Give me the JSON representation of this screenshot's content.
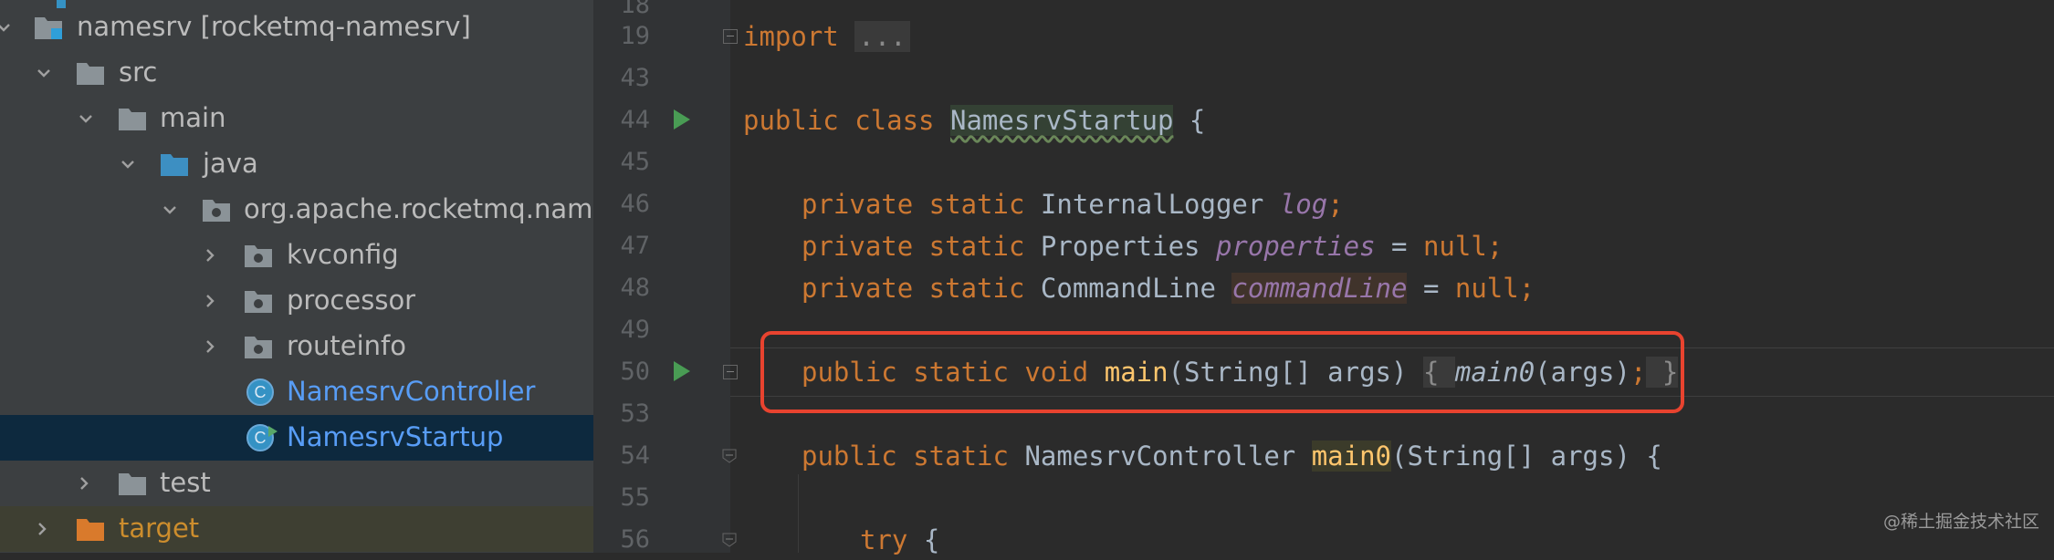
{
  "tree": {
    "items": [
      {
        "label": "namesrv [rocketmq-namesrv]",
        "kind": "module"
      },
      {
        "label": "src",
        "kind": "folder"
      },
      {
        "label": "main",
        "kind": "folder"
      },
      {
        "label": "java",
        "kind": "source-folder"
      },
      {
        "label": "org.apache.rocketmq.nam",
        "kind": "package"
      },
      {
        "label": "kvconfig",
        "kind": "package"
      },
      {
        "label": "processor",
        "kind": "package"
      },
      {
        "label": "routeinfo",
        "kind": "package"
      },
      {
        "label": "NamesrvController",
        "kind": "class"
      },
      {
        "label": "NamesrvStartup",
        "kind": "class-runnable",
        "selected": true
      },
      {
        "label": "test",
        "kind": "folder"
      },
      {
        "label": "target",
        "kind": "excluded-folder"
      }
    ]
  },
  "editor": {
    "lines": [
      {
        "num": "18"
      },
      {
        "num": "19",
        "text": "import",
        "folded": "..."
      },
      {
        "num": "43"
      },
      {
        "num": "44",
        "kw": "public class ",
        "name": "NamesrvStartup",
        "rest": " {"
      },
      {
        "num": "45"
      },
      {
        "num": "46",
        "kw": "private static ",
        "type": "InternalLogger ",
        "field": "log",
        "rest": ";"
      },
      {
        "num": "47",
        "kw": "private static ",
        "type": "Properties ",
        "field": "properties",
        "rest": " = ",
        "lit": "null",
        "end": ";"
      },
      {
        "num": "48",
        "kw": "private static ",
        "type": "CommandLine ",
        "field": "commandLine",
        "rest": " = ",
        "lit": "null",
        "end": ";"
      },
      {
        "num": "49"
      },
      {
        "num": "50",
        "kw": "public static void ",
        "method": "main",
        "params": "(String[] args) ",
        "brace_open": "{ ",
        "call": "main0",
        "args": "(args)",
        "semi": ";",
        "brace_close": " }"
      },
      {
        "num": "53"
      },
      {
        "num": "54",
        "kw": "public static ",
        "type": "NamesrvController ",
        "method": "main0",
        "params": "(String[] args) {"
      },
      {
        "num": "55"
      },
      {
        "num": "56",
        "kw": "try",
        "rest": " {"
      }
    ]
  },
  "watermark": "@稀土掘金技术社区",
  "colors": {
    "highlight": "#e8432f",
    "run": "#499c54",
    "keyword": "#cc7832"
  }
}
